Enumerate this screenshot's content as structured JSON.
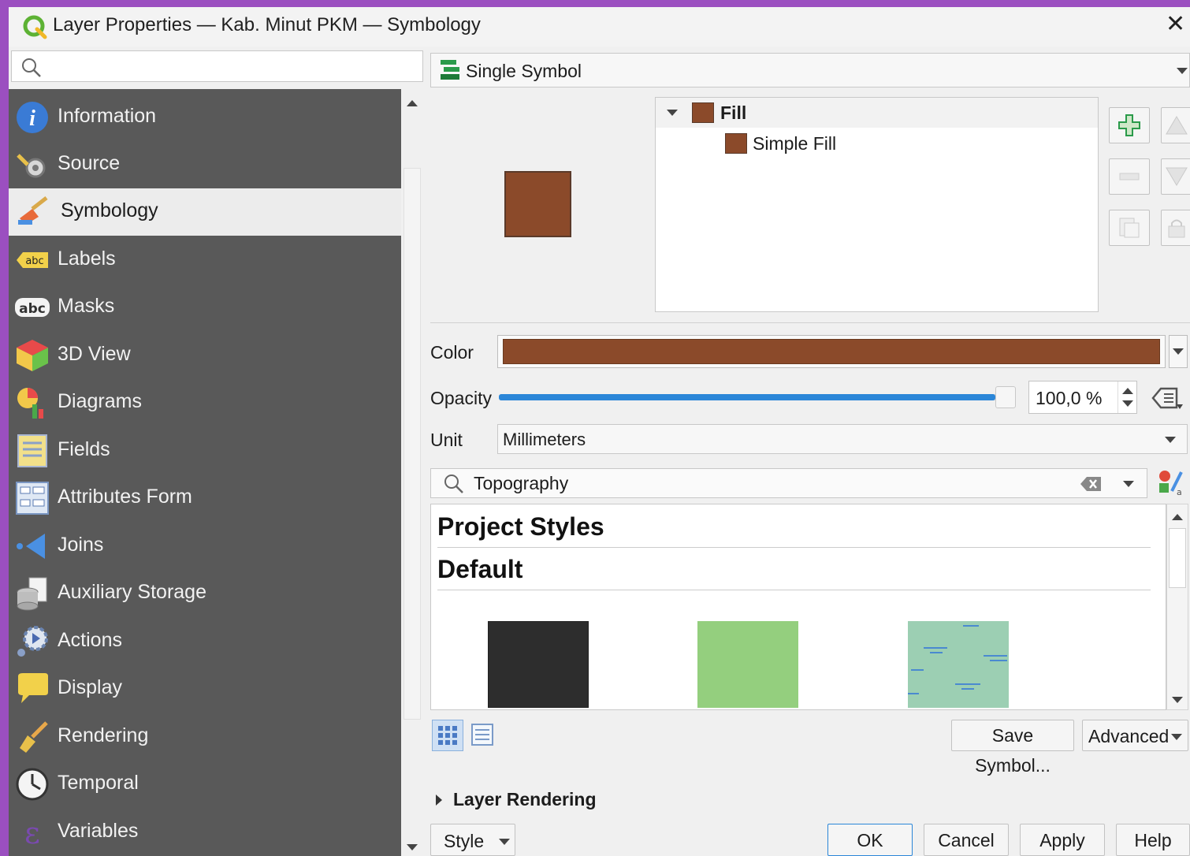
{
  "window": {
    "title": "Layer Properties — Kab. Minut PKM — Symbology",
    "close_icon": "close-icon"
  },
  "sidebar": {
    "items": [
      {
        "label": "Information",
        "icon": "info-icon"
      },
      {
        "label": "Source",
        "icon": "source-icon"
      },
      {
        "label": "Symbology",
        "icon": "symbology-icon",
        "active": true
      },
      {
        "label": "Labels",
        "icon": "labels-icon"
      },
      {
        "label": "Masks",
        "icon": "masks-icon"
      },
      {
        "label": "3D View",
        "icon": "3d-view-icon"
      },
      {
        "label": "Diagrams",
        "icon": "diagrams-icon"
      },
      {
        "label": "Fields",
        "icon": "fields-icon"
      },
      {
        "label": "Attributes Form",
        "icon": "attributes-form-icon"
      },
      {
        "label": "Joins",
        "icon": "joins-icon"
      },
      {
        "label": "Auxiliary Storage",
        "icon": "auxiliary-storage-icon"
      },
      {
        "label": "Actions",
        "icon": "actions-icon"
      },
      {
        "label": "Display",
        "icon": "display-icon"
      },
      {
        "label": "Rendering",
        "icon": "rendering-icon"
      },
      {
        "label": "Temporal",
        "icon": "temporal-icon"
      },
      {
        "label": "Variables",
        "icon": "variables-icon"
      }
    ]
  },
  "renderer": {
    "selected": "Single Symbol"
  },
  "symbol_tree": {
    "root": "Fill",
    "child": "Simple Fill"
  },
  "props": {
    "color_label": "Color",
    "color_value": "#8b4a2a",
    "opacity_label": "Opacity",
    "opacity_value": "100,0 %",
    "opacity_fraction": 1.0,
    "unit_label": "Unit",
    "unit_value": "Millimeters"
  },
  "library": {
    "search_value": "Topography",
    "groups": [
      "Project Styles",
      "Default"
    ],
    "swatches": [
      "#2d2d2d",
      "#94cf7e",
      "#9ccfb3"
    ]
  },
  "buttons": {
    "save_symbol": "Save Symbol...",
    "advanced": "Advanced",
    "layer_rendering": "Layer Rendering",
    "style": "Style",
    "ok": "OK",
    "cancel": "Cancel",
    "apply": "Apply",
    "help": "Help"
  },
  "colors": {
    "fill": "#8b4a2a",
    "sidebar_bg": "#595959",
    "accent_blue": "#2b86d8",
    "window_border": "#9b4fc0"
  }
}
